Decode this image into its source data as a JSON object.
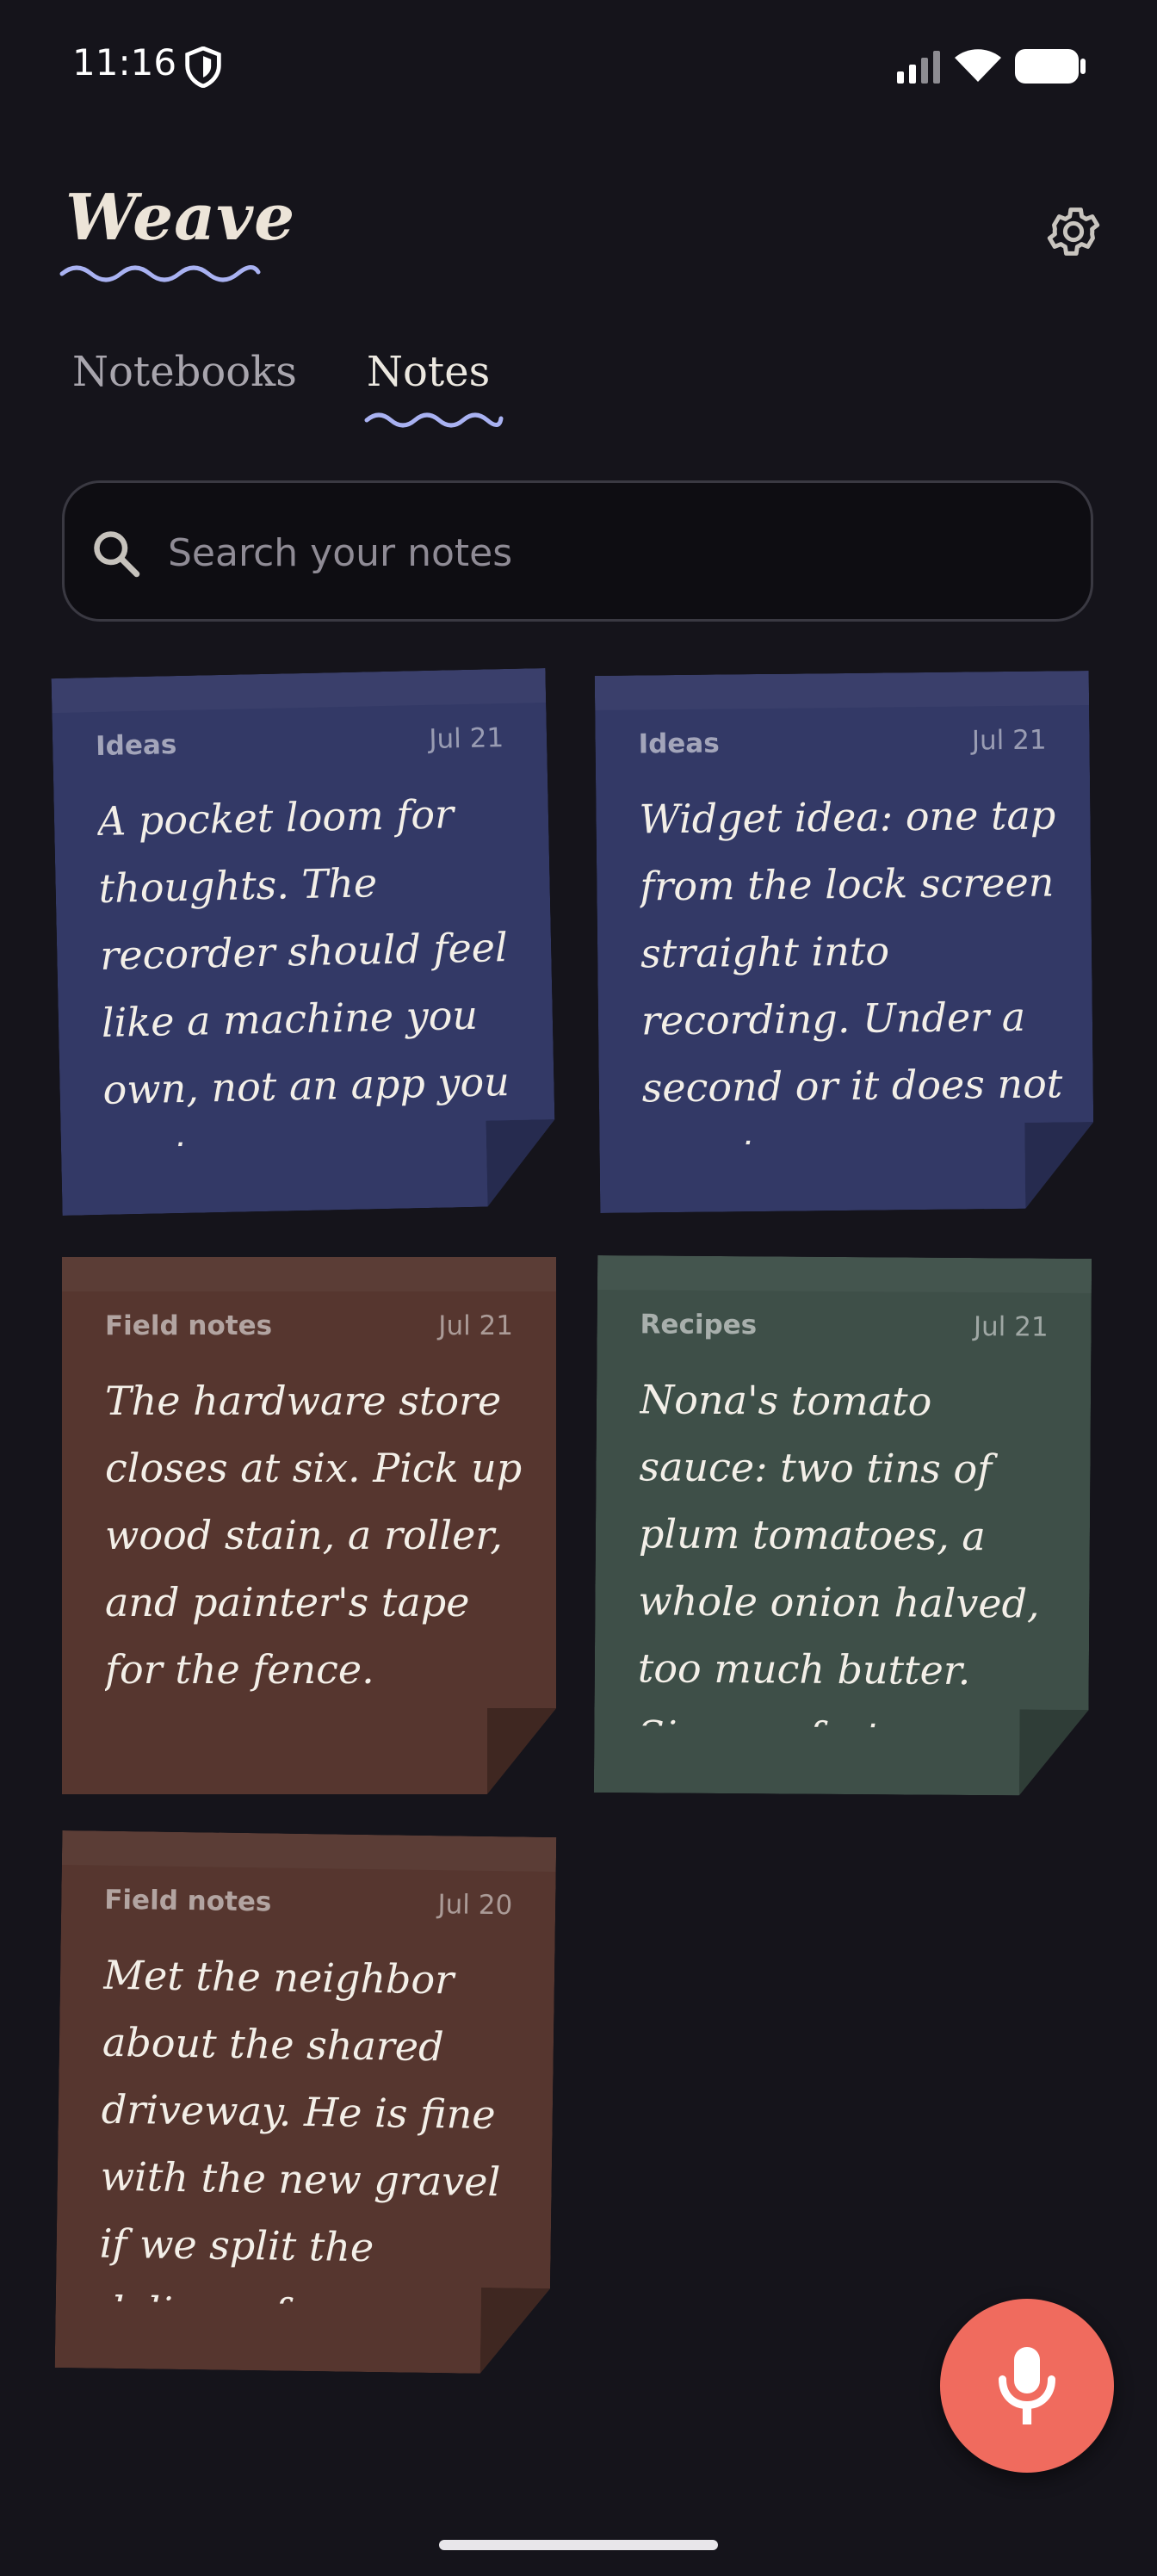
{
  "status_bar": {
    "time": "11:16",
    "icons": [
      "shield-icon",
      "signal-icon",
      "wifi-icon",
      "battery-icon"
    ]
  },
  "header": {
    "app_title": "Weave",
    "settings_icon": "gear-icon",
    "accent_color": "#a9b2f2"
  },
  "tabs": [
    {
      "label": "Notebooks",
      "selected": false
    },
    {
      "label": "Notes",
      "selected": true
    }
  ],
  "search": {
    "placeholder": "Search your notes",
    "value": ""
  },
  "notes": [
    {
      "category": "Ideas",
      "date": "Jul 21",
      "body": "A pocket loom for thoughts. The recorder should feel like a machine you own, not an app you rent.",
      "color": "#333966"
    },
    {
      "category": "Ideas",
      "date": "Jul 21",
      "body": "Widget idea: one tap from the lock screen straight into recording. Under a second or it does not count.",
      "color": "#333966"
    },
    {
      "category": "Field notes",
      "date": "Jul 21",
      "body": "The hardware store closes at six. Pick up wood stain, a roller, and painter's tape for the fence.",
      "color": "#56362f"
    },
    {
      "category": "Recipes",
      "date": "Jul 21",
      "body": "Nona's tomato sauce: two tins of plum tomatoes, a whole onion halved, too much butter. Simmer forty minutes.",
      "color": "#3e4f48"
    },
    {
      "category": "Field notes",
      "date": "Jul 20",
      "body": "Met the neighbor about the shared driveway. He is fine with the new gravel if we split the delivery fee.",
      "color": "#56362f"
    }
  ],
  "fab": {
    "icon": "microphone-icon",
    "color": "#f06b5e"
  }
}
